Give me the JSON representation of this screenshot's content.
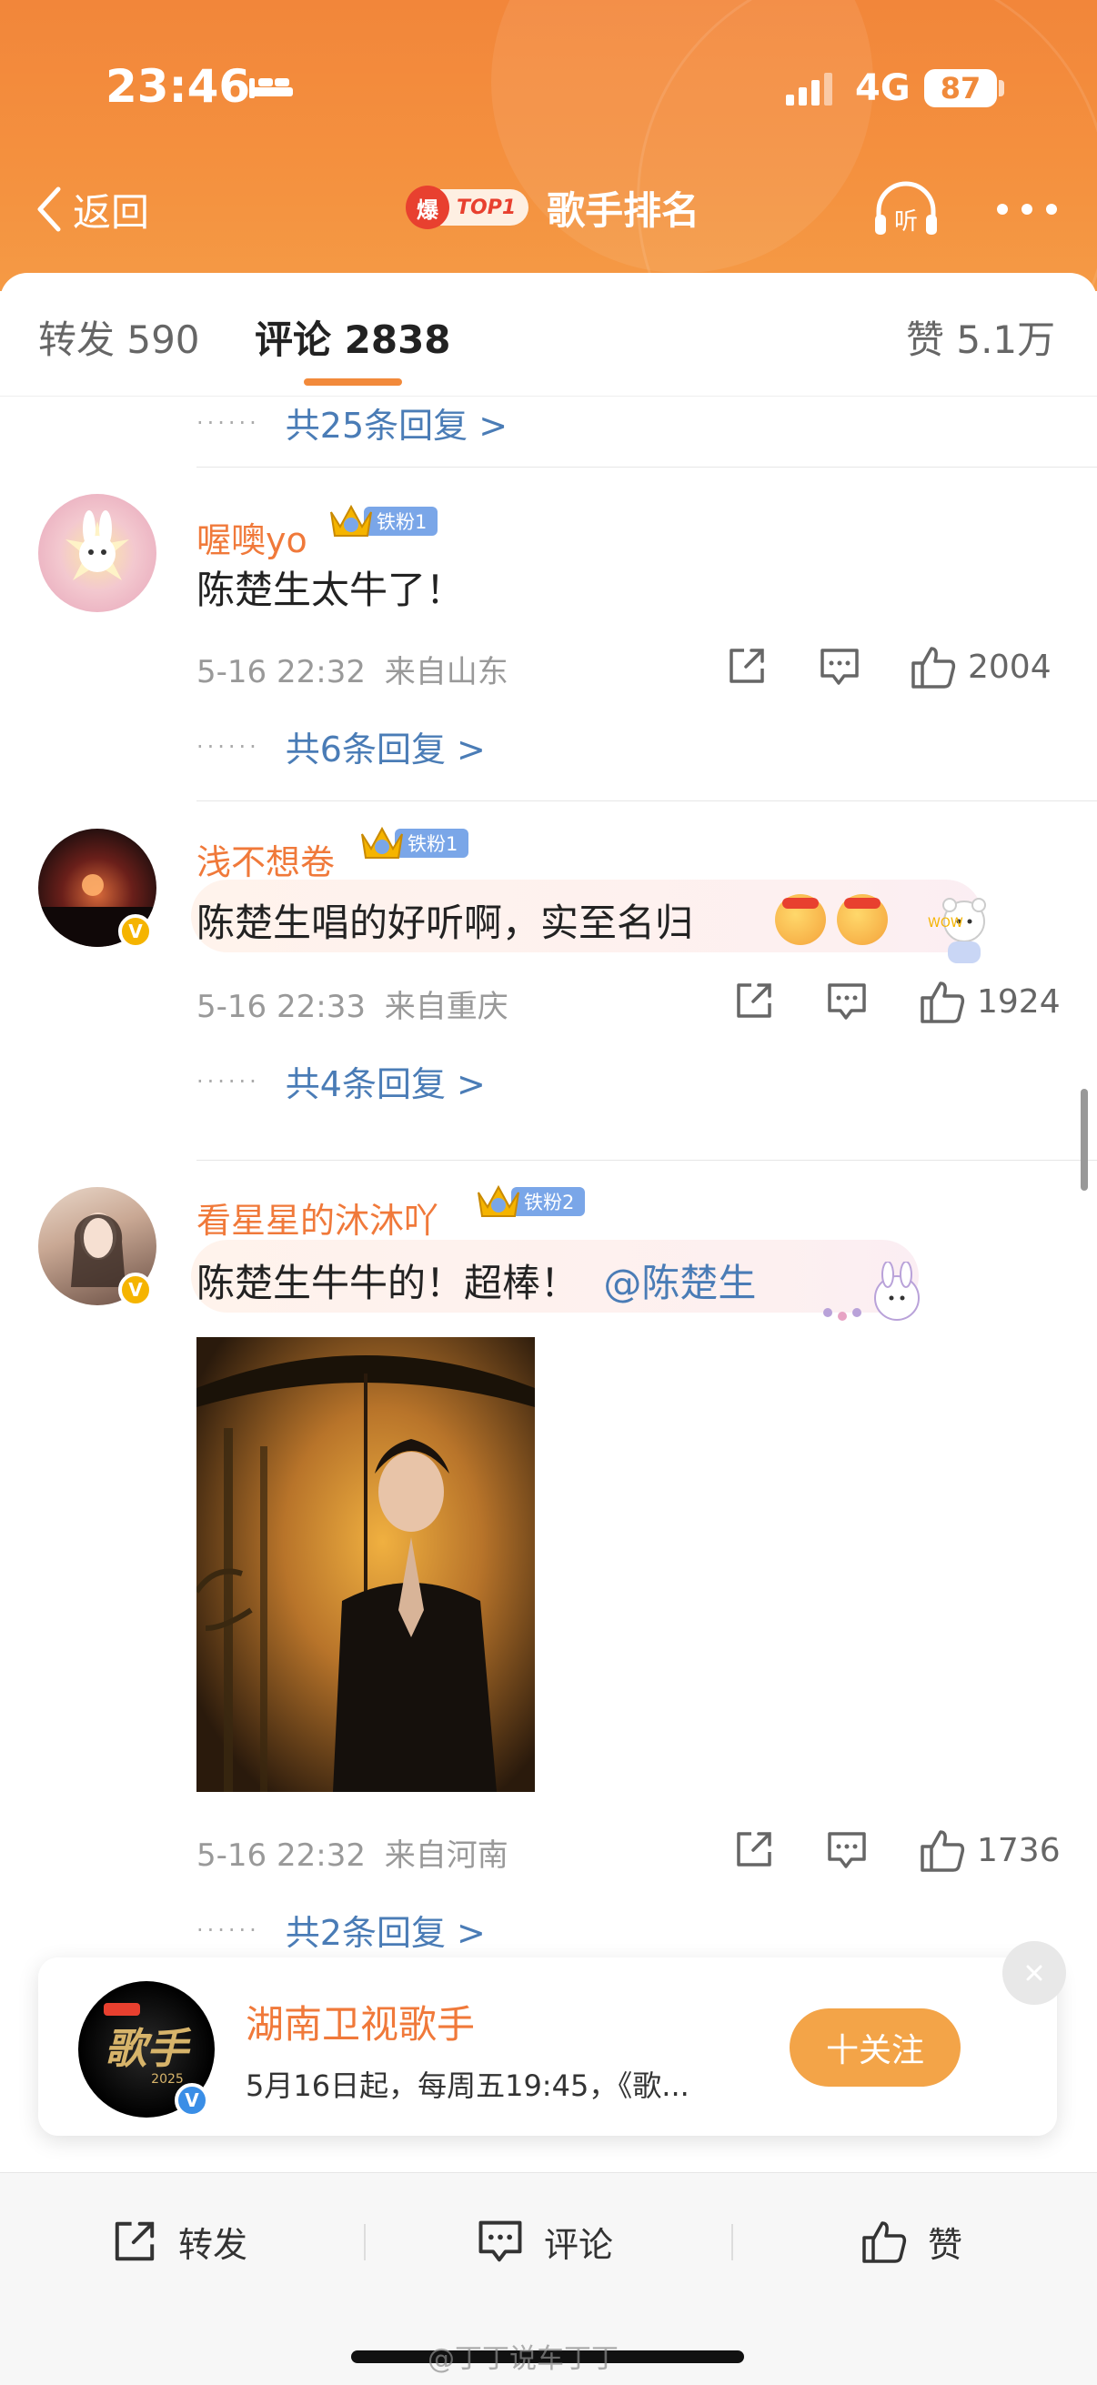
{
  "status": {
    "time": "23:46",
    "network": "4G",
    "battery": "87"
  },
  "header": {
    "back_label": "返回",
    "hot_badge": "爆",
    "top_badge": "TOP1",
    "title": "歌手排名",
    "listen_label": "听"
  },
  "tabs": {
    "repost": "转发 590",
    "comments": "评论 2838",
    "likes": "赞 5.1万"
  },
  "thread0": {
    "replies": "共25条回复 >"
  },
  "comments": [
    {
      "username": "喔噢yo",
      "fan_level": "铁粉1",
      "text": "陈楚生太牛了！",
      "time": "5-16 22:32",
      "location": "来自山东",
      "likes": "2004",
      "replies": "共6条回复 >"
    },
    {
      "username": "浅不想卷",
      "fan_level": "铁粉1",
      "text": "陈楚生唱的好听啊，实至名归",
      "time": "5-16 22:33",
      "location": "来自重庆",
      "likes": "1924",
      "replies": "共4条回复 >"
    },
    {
      "username": "看星星的沐沐吖",
      "fan_level": "铁粉2",
      "text": "陈楚生牛牛的！超棒！",
      "mention": "@陈楚生",
      "time": "5-16 22:32",
      "location": "来自河南",
      "likes": "1736",
      "replies": "共2条回复 >"
    }
  ],
  "follow_card": {
    "name": "湖南卫视歌手",
    "description": "5月16日起，每周五19:45，《歌...",
    "follow_label": "十关注",
    "logo_text": "歌手",
    "logo_year": "2025"
  },
  "bottombar": {
    "repost": "转发",
    "comment": "评论",
    "like": "赞"
  },
  "watermark": "@丁丁说车丁丁",
  "colors": {
    "accent": "#f28a3b",
    "username": "#f0793a",
    "link": "#4a7cb6"
  }
}
